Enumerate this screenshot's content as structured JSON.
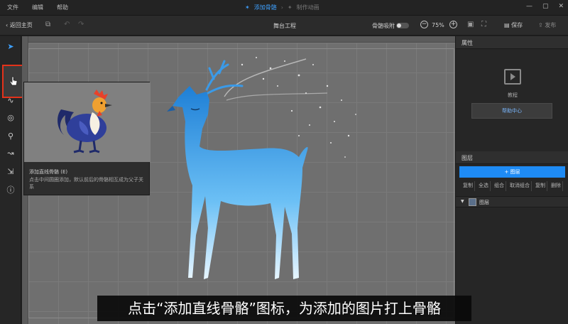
{
  "menu": [
    "文件",
    "编辑",
    "帮助"
  ],
  "breadcrumb": {
    "active": "添加骨骼",
    "inactive": "制作动画"
  },
  "toolbar": {
    "back_label": "返回主页",
    "center_title": "舞台工程",
    "snap_label": "骨骼吸附",
    "zoom": "75%",
    "save_label": "保存",
    "publish_label": "发布"
  },
  "tooltip": {
    "title": "添加直线骨骼 (E)",
    "description": "点击中间圆圈添加，默认前后的骨骼相互成为父子关系"
  },
  "right_panel": {
    "properties_title": "属性",
    "tutorial_label": "教程",
    "help_button": "帮助中心",
    "layers_title": "图层",
    "add_layer_button": "+ 图层",
    "layer_tools": [
      "复制",
      "全选",
      "组合",
      "取消组合",
      "复制",
      "删除"
    ],
    "layer_name": "图层"
  },
  "caption": "点击“添加直线骨骼”图标，为添加的图片打上骨骼",
  "colors": {
    "accent": "#1e8bf5",
    "highlight_border": "#e4321a",
    "canvas": "#6f6f6f"
  }
}
